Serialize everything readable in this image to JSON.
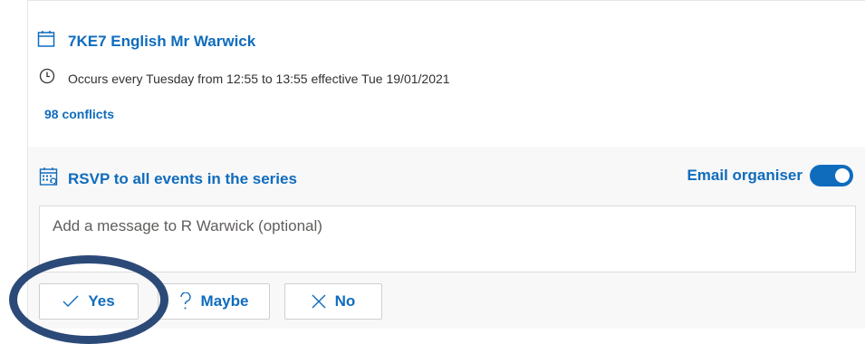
{
  "event": {
    "title": "7KE7 English Mr Warwick",
    "occurrence": "Occurs every Tuesday from 12:55 to 13:55 effective Tue 19/01/2021",
    "conflicts": "98 conflicts"
  },
  "rsvp": {
    "label": "RSVP to all events in the series",
    "email_label": "Email organiser",
    "email_toggle_on": true,
    "message_placeholder": "Add a message to R Warwick (optional)"
  },
  "buttons": {
    "yes": "Yes",
    "maybe": "Maybe",
    "no": "No"
  },
  "colors": {
    "accent": "#0f6cbd",
    "highlight": "#2c4a78"
  },
  "icons": {
    "title": "calendar-icon",
    "occurs": "clock-icon",
    "rsvp": "calendar-series-icon",
    "yes": "checkmark-icon",
    "maybe": "question-mark-icon",
    "no": "x-icon"
  }
}
